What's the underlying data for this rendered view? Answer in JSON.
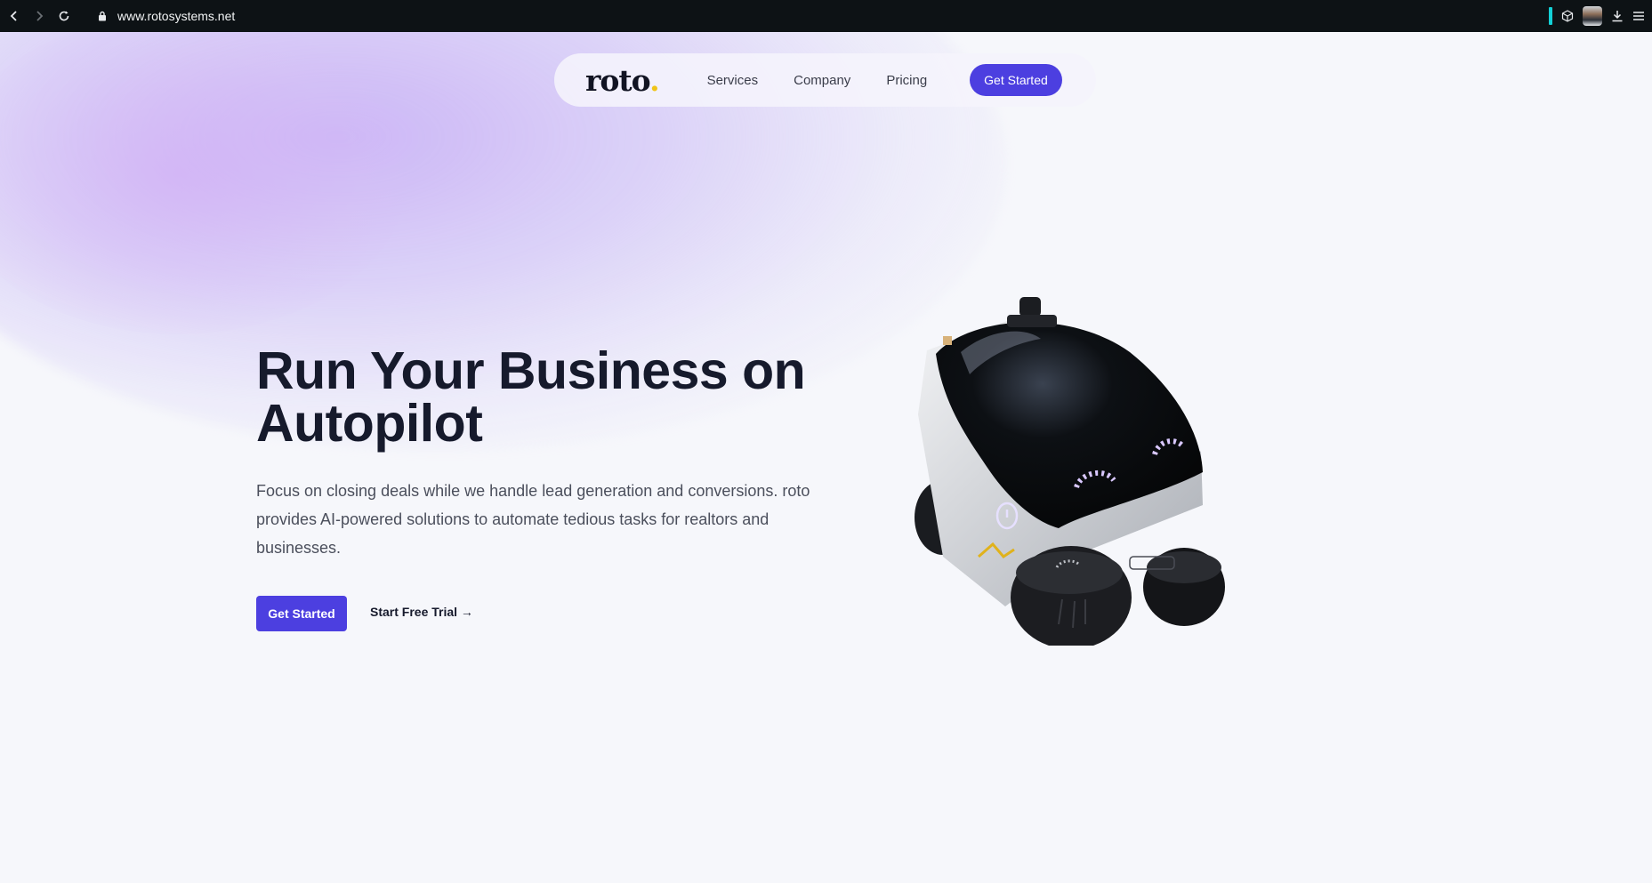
{
  "browser": {
    "url": "www.rotosystems.net",
    "icons": [
      "back-icon",
      "forward-icon",
      "reload-icon",
      "lock-icon",
      "extension-icon",
      "cube-icon",
      "profile-avatar",
      "download-icon",
      "menu-icon"
    ]
  },
  "nav": {
    "logo_text": "roto",
    "logo_dot": ".",
    "links": [
      "Services",
      "Company",
      "Pricing"
    ],
    "cta": "Get Started"
  },
  "hero": {
    "title": "Run Your Business on Autopilot",
    "description": "Focus on closing deals while we handle lead generation and conversions. roto provides AI-powered solutions to automate tedious tasks for realtors and businesses.",
    "primary_button": "Get Started",
    "secondary_button": "Start Free Trial →"
  },
  "colors": {
    "accent": "#4c3fe0",
    "logo_dot": "#f0c419",
    "title": "#161a2c",
    "browser_bar": "#0d1215",
    "background": "#f6f7fb"
  }
}
